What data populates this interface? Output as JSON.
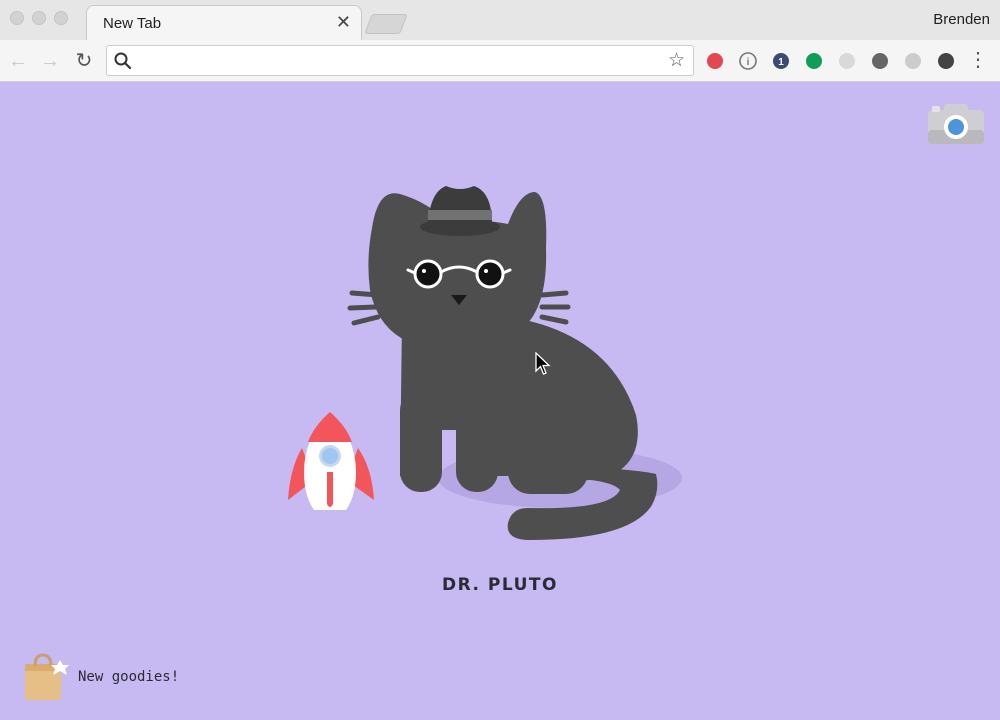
{
  "browser": {
    "tab_title": "New Tab",
    "tab_close_glyph": "✕",
    "profile_name": "Brenden",
    "omnibox": {
      "value": "",
      "placeholder": ""
    },
    "nav": {
      "back_glyph": "←",
      "forward_glyph": "→",
      "reload_glyph": "↻"
    },
    "star_glyph": "☆",
    "menu_glyph": "⋮",
    "extensions": [
      {
        "name": "creative-cloud-extension-icon",
        "color": "#e34850",
        "badge": ""
      },
      {
        "name": "info-extension-icon",
        "color": "#777777",
        "badge": "i"
      },
      {
        "name": "onepassword-extension-icon",
        "color": "#3b4b73",
        "badge": "1"
      },
      {
        "name": "hangouts-extension-icon",
        "color": "#0f9d58",
        "badge": ""
      },
      {
        "name": "grey-extension-icon",
        "color": "#d9d9d9",
        "badge": ""
      },
      {
        "name": "mail-extension-icon",
        "color": "#666666",
        "badge": ""
      },
      {
        "name": "dashed-extension-icon",
        "color": "#cccccc",
        "badge": ""
      },
      {
        "name": "pen-extension-icon",
        "color": "#444444",
        "badge": ""
      }
    ]
  },
  "page": {
    "background": "#c7b9f1",
    "pet_name": "DR. PLUTO",
    "goodies_label": "New goodies!",
    "colors": {
      "cat": "#4e4e4e",
      "hat": "#3c3c3c",
      "rocket_red": "#f2555a",
      "rocket_window": "#9ec7f2",
      "bag": "#e5bf85"
    }
  }
}
